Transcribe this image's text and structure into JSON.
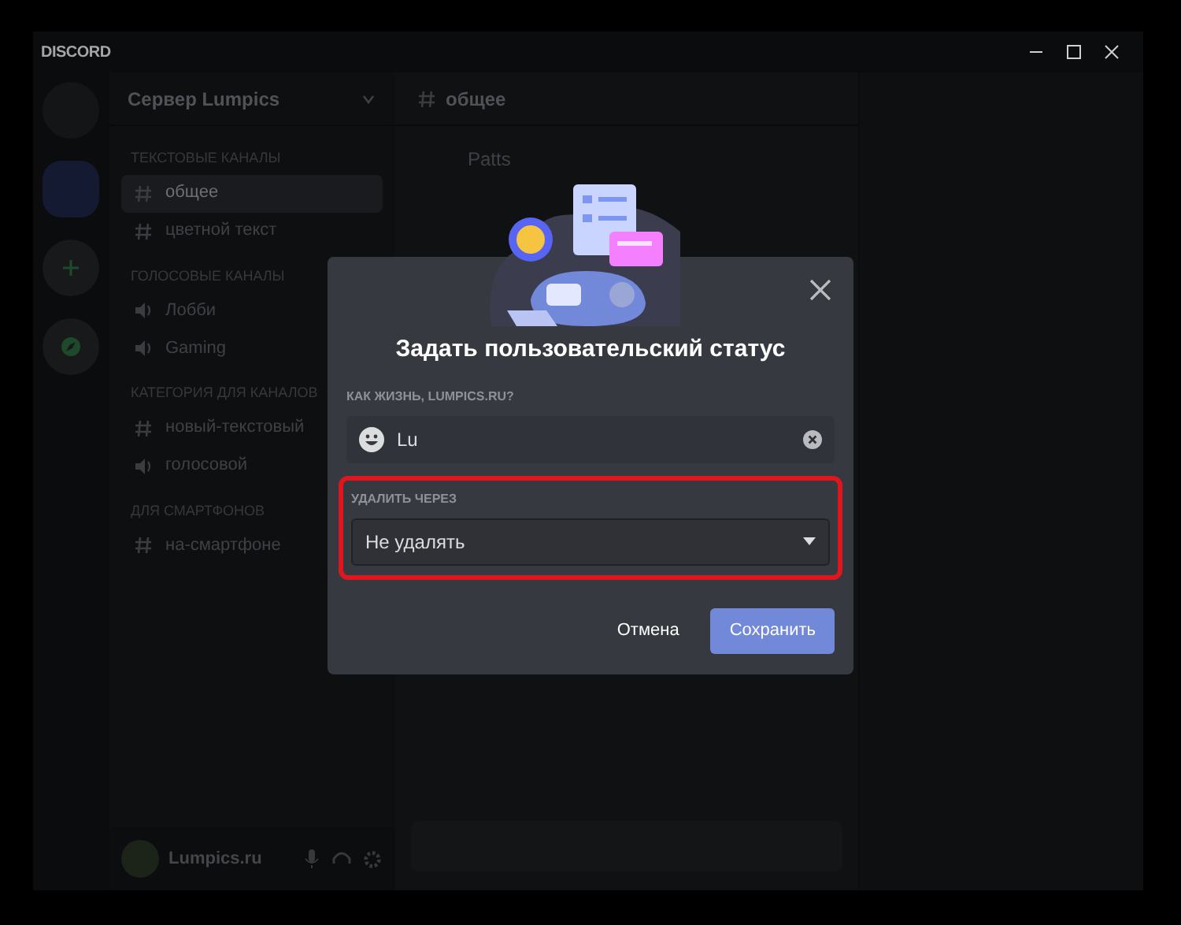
{
  "window": {
    "title": "DISCORD"
  },
  "server": {
    "name": "Сервер Lumpics"
  },
  "categories": [
    {
      "name": "ТЕКСТОВЫЕ КАНАЛЫ",
      "channels": [
        {
          "name": "общее",
          "kind": "text",
          "selected": true
        },
        {
          "name": "цветной текст",
          "kind": "text",
          "selected": false
        }
      ]
    },
    {
      "name": "ГОЛОСОВЫЕ КАНАЛЫ",
      "channels": [
        {
          "name": "Лобби",
          "kind": "voice",
          "selected": false
        },
        {
          "name": "Gaming",
          "kind": "voice",
          "selected": false
        }
      ]
    },
    {
      "name": "КАТЕГОРИЯ ДЛЯ КАНАЛОВ",
      "channels": [
        {
          "name": "новый-текстовый",
          "kind": "text",
          "selected": false
        },
        {
          "name": "голосовой",
          "kind": "voice",
          "selected": false
        }
      ]
    },
    {
      "name": "ДЛЯ СМАРТФОНОВ",
      "channels": [
        {
          "name": "на-смартфоне",
          "kind": "text",
          "selected": false
        }
      ]
    }
  ],
  "user": {
    "name": "Lumpics.ru"
  },
  "channel_header": {
    "name": "общее"
  },
  "messages": [
    {
      "author": "Patts"
    }
  ],
  "dialog": {
    "title": "Задать пользовательский статус",
    "status_label": "КАК ЖИЗНЬ, LUMPICS.RU?",
    "status_value": "Lu",
    "clear_label": "УДАЛИТЬ ЧЕРЕЗ",
    "clear_value": "Не удалять",
    "highlighted": true,
    "buttons": [
      {
        "label": "Отмена",
        "kind": "link"
      },
      {
        "label": "Сохранить",
        "kind": "primary"
      }
    ]
  }
}
